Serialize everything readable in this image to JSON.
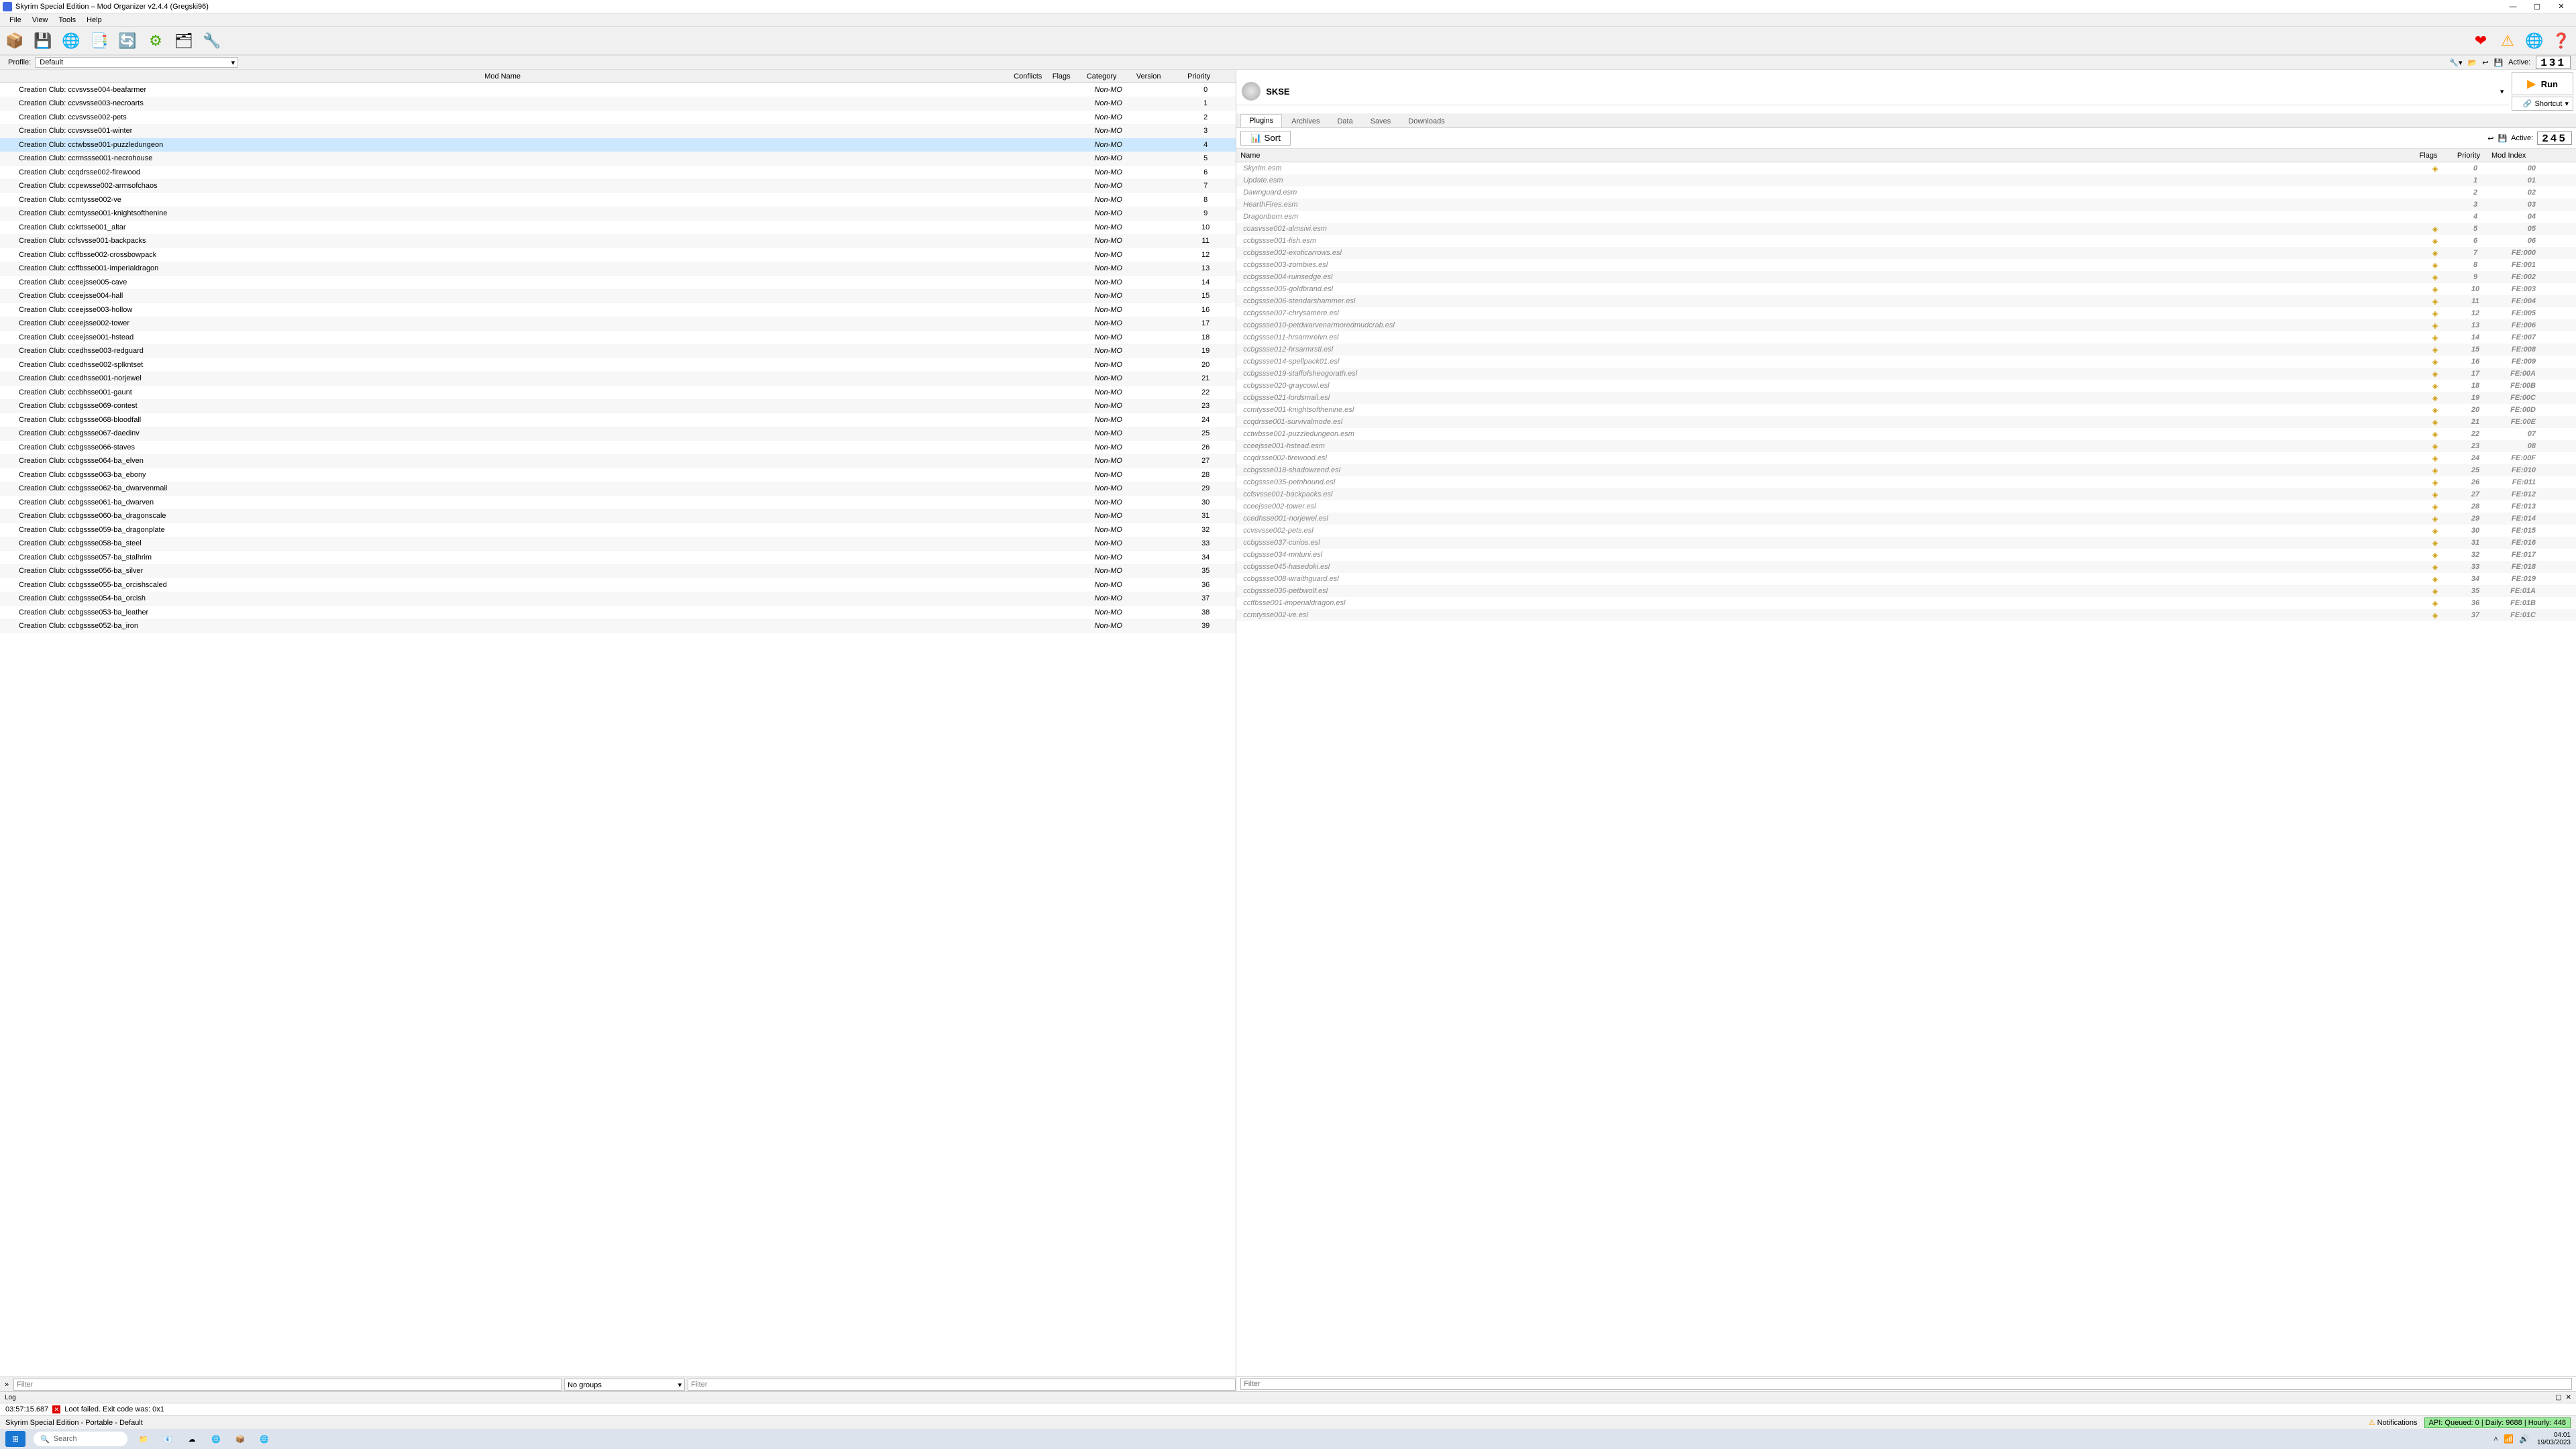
{
  "titlebar": {
    "title": "Skyrim Special Edition – Mod Organizer v2.4.4 (Gregski96)"
  },
  "menu": {
    "items": [
      "File",
      "View",
      "Tools",
      "Help"
    ]
  },
  "profile": {
    "label": "Profile:",
    "value": "Default",
    "active_label": "Active:",
    "active_value": "131"
  },
  "mod_table": {
    "headers": {
      "name": "Mod Name",
      "conflicts": "Conflicts",
      "flags": "Flags",
      "category": "Category",
      "version": "Version",
      "priority": "Priority"
    },
    "selected_index": 4,
    "rows": [
      {
        "name": "Creation Club: ccvsvsse004-beafarmer",
        "category": "Non-MO",
        "priority": "0"
      },
      {
        "name": "Creation Club: ccvsvsse003-necroarts",
        "category": "Non-MO",
        "priority": "1"
      },
      {
        "name": "Creation Club: ccvsvsse002-pets",
        "category": "Non-MO",
        "priority": "2"
      },
      {
        "name": "Creation Club: ccvsvsse001-winter",
        "category": "Non-MO",
        "priority": "3"
      },
      {
        "name": "Creation Club: cctwbsse001-puzzledungeon",
        "category": "Non-MO",
        "priority": "4"
      },
      {
        "name": "Creation Club: ccrmssse001-necrohouse",
        "category": "Non-MO",
        "priority": "5"
      },
      {
        "name": "Creation Club: ccqdrsse002-firewood",
        "category": "Non-MO",
        "priority": "6"
      },
      {
        "name": "Creation Club: ccpewsse002-armsofchaos",
        "category": "Non-MO",
        "priority": "7"
      },
      {
        "name": "Creation Club: ccmtysse002-ve",
        "category": "Non-MO",
        "priority": "8"
      },
      {
        "name": "Creation Club: ccmtysse001-knightsofthenine",
        "category": "Non-MO",
        "priority": "9"
      },
      {
        "name": "Creation Club: cckrtsse001_altar",
        "category": "Non-MO",
        "priority": "10"
      },
      {
        "name": "Creation Club: ccfsvsse001-backpacks",
        "category": "Non-MO",
        "priority": "11"
      },
      {
        "name": "Creation Club: ccffbsse002-crossbowpack",
        "category": "Non-MO",
        "priority": "12"
      },
      {
        "name": "Creation Club: ccffbsse001-imperialdragon",
        "category": "Non-MO",
        "priority": "13"
      },
      {
        "name": "Creation Club: cceejsse005-cave",
        "category": "Non-MO",
        "priority": "14"
      },
      {
        "name": "Creation Club: cceejsse004-hall",
        "category": "Non-MO",
        "priority": "15"
      },
      {
        "name": "Creation Club: cceejsse003-hollow",
        "category": "Non-MO",
        "priority": "16"
      },
      {
        "name": "Creation Club: cceejsse002-tower",
        "category": "Non-MO",
        "priority": "17"
      },
      {
        "name": "Creation Club: cceejsse001-hstead",
        "category": "Non-MO",
        "priority": "18"
      },
      {
        "name": "Creation Club: ccedhsse003-redguard",
        "category": "Non-MO",
        "priority": "19"
      },
      {
        "name": "Creation Club: ccedhsse002-splkntset",
        "category": "Non-MO",
        "priority": "20"
      },
      {
        "name": "Creation Club: ccedhsse001-norjewel",
        "category": "Non-MO",
        "priority": "21"
      },
      {
        "name": "Creation Club: cccbhsse001-gaunt",
        "category": "Non-MO",
        "priority": "22"
      },
      {
        "name": "Creation Club: ccbgssse069-contest",
        "category": "Non-MO",
        "priority": "23"
      },
      {
        "name": "Creation Club: ccbgssse068-bloodfall",
        "category": "Non-MO",
        "priority": "24"
      },
      {
        "name": "Creation Club: ccbgssse067-daedinv",
        "category": "Non-MO",
        "priority": "25"
      },
      {
        "name": "Creation Club: ccbgssse066-staves",
        "category": "Non-MO",
        "priority": "26"
      },
      {
        "name": "Creation Club: ccbgssse064-ba_elven",
        "category": "Non-MO",
        "priority": "27"
      },
      {
        "name": "Creation Club: ccbgssse063-ba_ebony",
        "category": "Non-MO",
        "priority": "28"
      },
      {
        "name": "Creation Club: ccbgssse062-ba_dwarvenmail",
        "category": "Non-MO",
        "priority": "29"
      },
      {
        "name": "Creation Club: ccbgssse061-ba_dwarven",
        "category": "Non-MO",
        "priority": "30"
      },
      {
        "name": "Creation Club: ccbgssse060-ba_dragonscale",
        "category": "Non-MO",
        "priority": "31"
      },
      {
        "name": "Creation Club: ccbgssse059-ba_dragonplate",
        "category": "Non-MO",
        "priority": "32"
      },
      {
        "name": "Creation Club: ccbgssse058-ba_steel",
        "category": "Non-MO",
        "priority": "33"
      },
      {
        "name": "Creation Club: ccbgssse057-ba_stalhrim",
        "category": "Non-MO",
        "priority": "34"
      },
      {
        "name": "Creation Club: ccbgssse056-ba_silver",
        "category": "Non-MO",
        "priority": "35"
      },
      {
        "name": "Creation Club: ccbgssse055-ba_orcishscaled",
        "category": "Non-MO",
        "priority": "36"
      },
      {
        "name": "Creation Club: ccbgssse054-ba_orcish",
        "category": "Non-MO",
        "priority": "37"
      },
      {
        "name": "Creation Club: ccbgssse053-ba_leather",
        "category": "Non-MO",
        "priority": "38"
      },
      {
        "name": "Creation Club: ccbgssse052-ba_iron",
        "category": "Non-MO",
        "priority": "39"
      }
    ]
  },
  "left_filter": {
    "expand": "»",
    "placeholder": "Filter",
    "group": "No groups",
    "placeholder2": "Filter"
  },
  "exec": {
    "name": "SKSE",
    "run": "Run",
    "shortcut": "Shortcut"
  },
  "tabs": {
    "items": [
      "Plugins",
      "Archives",
      "Data",
      "Saves",
      "Downloads"
    ],
    "active": 0
  },
  "plugin_toolbar": {
    "sort": "Sort",
    "active_label": "Active:",
    "active_value": "245"
  },
  "plugin_table": {
    "headers": {
      "name": "Name",
      "flags": "Flags",
      "priority": "Priority",
      "modindex": "Mod Index"
    },
    "rows": [
      {
        "name": "Skyrim.esm",
        "flag": true,
        "priority": "0",
        "idx": "00"
      },
      {
        "name": "Update.esm",
        "flag": false,
        "priority": "1",
        "idx": "01"
      },
      {
        "name": "Dawnguard.esm",
        "flag": false,
        "priority": "2",
        "idx": "02"
      },
      {
        "name": "HearthFires.esm",
        "flag": false,
        "priority": "3",
        "idx": "03"
      },
      {
        "name": "Dragonborn.esm",
        "flag": false,
        "priority": "4",
        "idx": "04"
      },
      {
        "name": "ccasvsse001-almsivi.esm",
        "flag": true,
        "priority": "5",
        "idx": "05"
      },
      {
        "name": "ccbgssse001-fish.esm",
        "flag": true,
        "priority": "6",
        "idx": "06"
      },
      {
        "name": "ccbgssse002-exoticarrows.esl",
        "flag": true,
        "priority": "7",
        "idx": "FE:000"
      },
      {
        "name": "ccbgssse003-zombies.esl",
        "flag": true,
        "priority": "8",
        "idx": "FE:001"
      },
      {
        "name": "ccbgssse004-ruinsedge.esl",
        "flag": true,
        "priority": "9",
        "idx": "FE:002"
      },
      {
        "name": "ccbgssse005-goldbrand.esl",
        "flag": true,
        "priority": "10",
        "idx": "FE:003"
      },
      {
        "name": "ccbgssse006-stendarshammer.esl",
        "flag": true,
        "priority": "11",
        "idx": "FE:004"
      },
      {
        "name": "ccbgssse007-chrysamere.esl",
        "flag": true,
        "priority": "12",
        "idx": "FE:005"
      },
      {
        "name": "ccbgssse010-petdwarvenarmoredmudcrab.esl",
        "flag": true,
        "priority": "13",
        "idx": "FE:006"
      },
      {
        "name": "ccbgssse011-hrsarmrelvn.esl",
        "flag": true,
        "priority": "14",
        "idx": "FE:007"
      },
      {
        "name": "ccbgssse012-hrsarmrstl.esl",
        "flag": true,
        "priority": "15",
        "idx": "FE:008"
      },
      {
        "name": "ccbgssse014-spellpack01.esl",
        "flag": true,
        "priority": "16",
        "idx": "FE:009"
      },
      {
        "name": "ccbgssse019-staffofsheogorath.esl",
        "flag": true,
        "priority": "17",
        "idx": "FE:00A"
      },
      {
        "name": "ccbgssse020-graycowl.esl",
        "flag": true,
        "priority": "18",
        "idx": "FE:00B"
      },
      {
        "name": "ccbgssse021-lordsmail.esl",
        "flag": true,
        "priority": "19",
        "idx": "FE:00C"
      },
      {
        "name": "ccmtysse001-knightsofthenine.esl",
        "flag": true,
        "priority": "20",
        "idx": "FE:00D"
      },
      {
        "name": "ccqdrsse001-survivalmode.esl",
        "flag": true,
        "priority": "21",
        "idx": "FE:00E"
      },
      {
        "name": "cctwbsse001-puzzledungeon.esm",
        "flag": true,
        "priority": "22",
        "idx": "07"
      },
      {
        "name": "cceejsse001-hstead.esm",
        "flag": true,
        "priority": "23",
        "idx": "08"
      },
      {
        "name": "ccqdrsse002-firewood.esl",
        "flag": true,
        "priority": "24",
        "idx": "FE:00F"
      },
      {
        "name": "ccbgssse018-shadowrend.esl",
        "flag": true,
        "priority": "25",
        "idx": "FE:010"
      },
      {
        "name": "ccbgssse035-petnhound.esl",
        "flag": true,
        "priority": "26",
        "idx": "FE:011"
      },
      {
        "name": "ccfsvsse001-backpacks.esl",
        "flag": true,
        "priority": "27",
        "idx": "FE:012"
      },
      {
        "name": "cceejsse002-tower.esl",
        "flag": true,
        "priority": "28",
        "idx": "FE:013"
      },
      {
        "name": "ccedhsse001-norjewel.esl",
        "flag": true,
        "priority": "29",
        "idx": "FE:014"
      },
      {
        "name": "ccvsvsse002-pets.esl",
        "flag": true,
        "priority": "30",
        "idx": "FE:015"
      },
      {
        "name": "ccbgssse037-curios.esl",
        "flag": true,
        "priority": "31",
        "idx": "FE:016"
      },
      {
        "name": "ccbgssse034-mntuni.esl",
        "flag": true,
        "priority": "32",
        "idx": "FE:017"
      },
      {
        "name": "ccbgssse045-hasedoki.esl",
        "flag": true,
        "priority": "33",
        "idx": "FE:018"
      },
      {
        "name": "ccbgssse008-wraithguard.esl",
        "flag": true,
        "priority": "34",
        "idx": "FE:019"
      },
      {
        "name": "ccbgssse036-petbwolf.esl",
        "flag": true,
        "priority": "35",
        "idx": "FE:01A"
      },
      {
        "name": "ccffbsse001-imperialdragon.esl",
        "flag": true,
        "priority": "36",
        "idx": "FE:01B"
      },
      {
        "name": "ccmtysse002-ve.esl",
        "flag": true,
        "priority": "37",
        "idx": "FE:01C"
      }
    ]
  },
  "right_filter": {
    "placeholder": "Filter"
  },
  "log": {
    "label": "Log",
    "time": "03:57:15.687",
    "msg": "Loot failed. Exit code was: 0x1"
  },
  "status": {
    "left": "Skyrim Special Edition - Portable - Default",
    "notif": "Notifications",
    "api": "API: Queued: 0 | Daily: 9688 | Hourly: 448"
  },
  "taskbar": {
    "search": "Search",
    "time": "04:01",
    "date": "19/03/2023"
  }
}
